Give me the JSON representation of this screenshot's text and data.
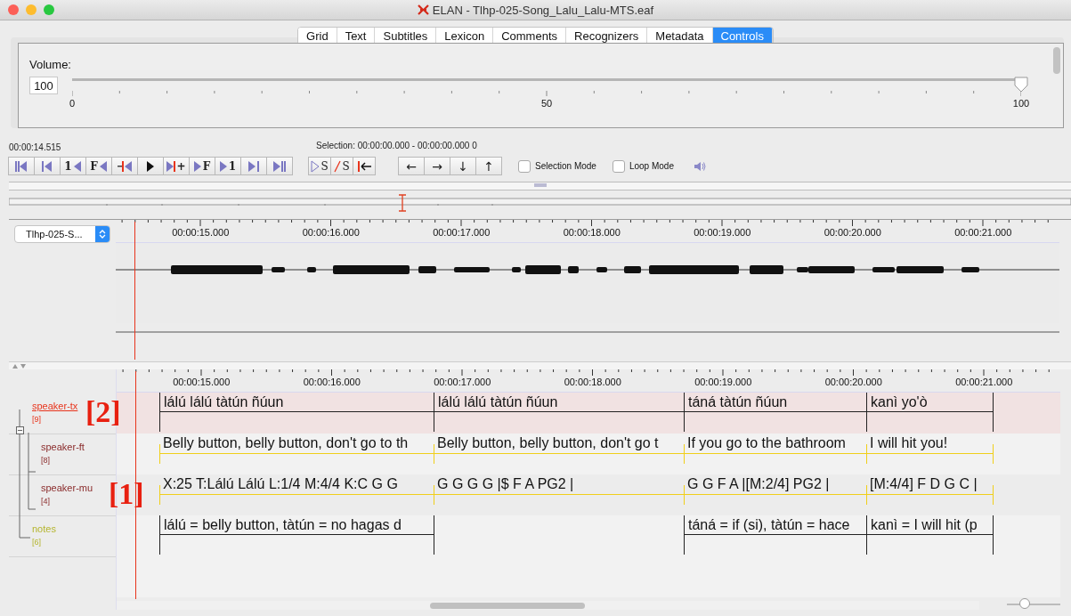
{
  "window": {
    "title": "ELAN - Tlhp-025-Song_Lalu_Lalu-MTS.eaf"
  },
  "tabs": [
    {
      "label": "Grid",
      "selected": false
    },
    {
      "label": "Text",
      "selected": false
    },
    {
      "label": "Subtitles",
      "selected": false
    },
    {
      "label": "Lexicon",
      "selected": false
    },
    {
      "label": "Comments",
      "selected": false
    },
    {
      "label": "Recognizers",
      "selected": false
    },
    {
      "label": "Metadata",
      "selected": false
    },
    {
      "label": "Controls",
      "selected": true
    }
  ],
  "volume": {
    "label": "Volume:",
    "value": "100",
    "level": 1,
    "scale": [
      "0",
      "50",
      "100"
    ]
  },
  "player": {
    "time": "00:00:14.515",
    "selection": "Selection: 00:00:00.000 - 00:00:00.000  0",
    "transport": [
      {
        "kind": "bars-left"
      },
      {
        "kind": "bar-left"
      },
      {
        "kind": "text-left",
        "label": "1"
      },
      {
        "kind": "text-left",
        "label": "F"
      },
      {
        "kind": "redbar-left"
      },
      {
        "kind": "play"
      },
      {
        "kind": "right-redbar",
        "label": "+"
      },
      {
        "kind": "right-text",
        "label": "F"
      },
      {
        "kind": "right-text",
        "label": "1"
      },
      {
        "kind": "right-bar"
      },
      {
        "kind": "right-bars"
      }
    ],
    "selection_buttons": [
      {
        "kind": "outline-text",
        "label": "S"
      },
      {
        "kind": "strike-text",
        "label": "S"
      },
      {
        "kind": "redbar-arrow"
      }
    ],
    "arrows": [
      {
        "label": "←"
      },
      {
        "label": "→"
      },
      {
        "label": "↓"
      },
      {
        "label": "↑"
      }
    ],
    "checkboxes": [
      {
        "label": "Selection Mode",
        "checked": false
      },
      {
        "label": "Loop Mode",
        "checked": false
      }
    ]
  },
  "waveform": {
    "media": "Tlhp-025-S...",
    "ticks": [
      "00:00:15.000",
      "00:00:16.000",
      "00:00:17.000",
      "00:00:18.000",
      "00:00:19.000",
      "00:00:20.000",
      "00:00:21.000"
    ]
  },
  "annotations": {
    "ticks": [
      "00:00:15.000",
      "00:00:16.000",
      "00:00:17.000",
      "00:00:18.000",
      "00:00:19.000",
      "00:00:20.000",
      "00:00:21.000"
    ],
    "tiers": [
      {
        "name": "speaker-tx",
        "count": "[9]",
        "color": "#e8341c",
        "selected": true,
        "kind": "independent",
        "callout": "[2]",
        "annotations": [
          {
            "text": "lálú lálú tàtún ñúun"
          },
          {
            "text": "lálú lálú tàtún ñúun"
          },
          {
            "text": "táná tàtún ñúun"
          },
          {
            "text": "kanì yo'ò"
          }
        ],
        "children": [
          {
            "name": "speaker-ft",
            "count": "[8]",
            "color": "#8a2b2b",
            "selected": false,
            "kind": "dependent",
            "annotations": [
              {
                "text": "Belly button, belly button, don't go to th"
              },
              {
                "text": "Belly button, belly button, don't go t"
              },
              {
                "text": "If you go to the bathroom"
              },
              {
                "text": "I will hit you!"
              }
            ]
          },
          {
            "name": "speaker-mu",
            "count": "[4]",
            "color": "#8a2b2b",
            "selected": false,
            "kind": "dependent",
            "callout": "[1]",
            "annotations": [
              {
                "text": "X:25 T:Lálú Lálú L:1/4 M:4/4 K:C G G"
              },
              {
                "text": "G G G G |$ F A PG2 |"
              },
              {
                "text": "G G F A |[M:2/4] PG2 |"
              },
              {
                "text": "[M:4/4] F D G C |"
              }
            ]
          }
        ]
      },
      {
        "name": "notes",
        "count": "[6]",
        "color": "#b5b52e",
        "selected": false,
        "kind": "independent",
        "annotations": [
          {
            "text": "lálú = belly button, tàtún = no hagas d"
          },
          {
            "text": "táná = if (si), tàtún = hace",
            "gap_before": true
          },
          {
            "text": "kanì = I will hit (p"
          }
        ]
      }
    ]
  },
  "zoom": {
    "level": 0.33
  }
}
